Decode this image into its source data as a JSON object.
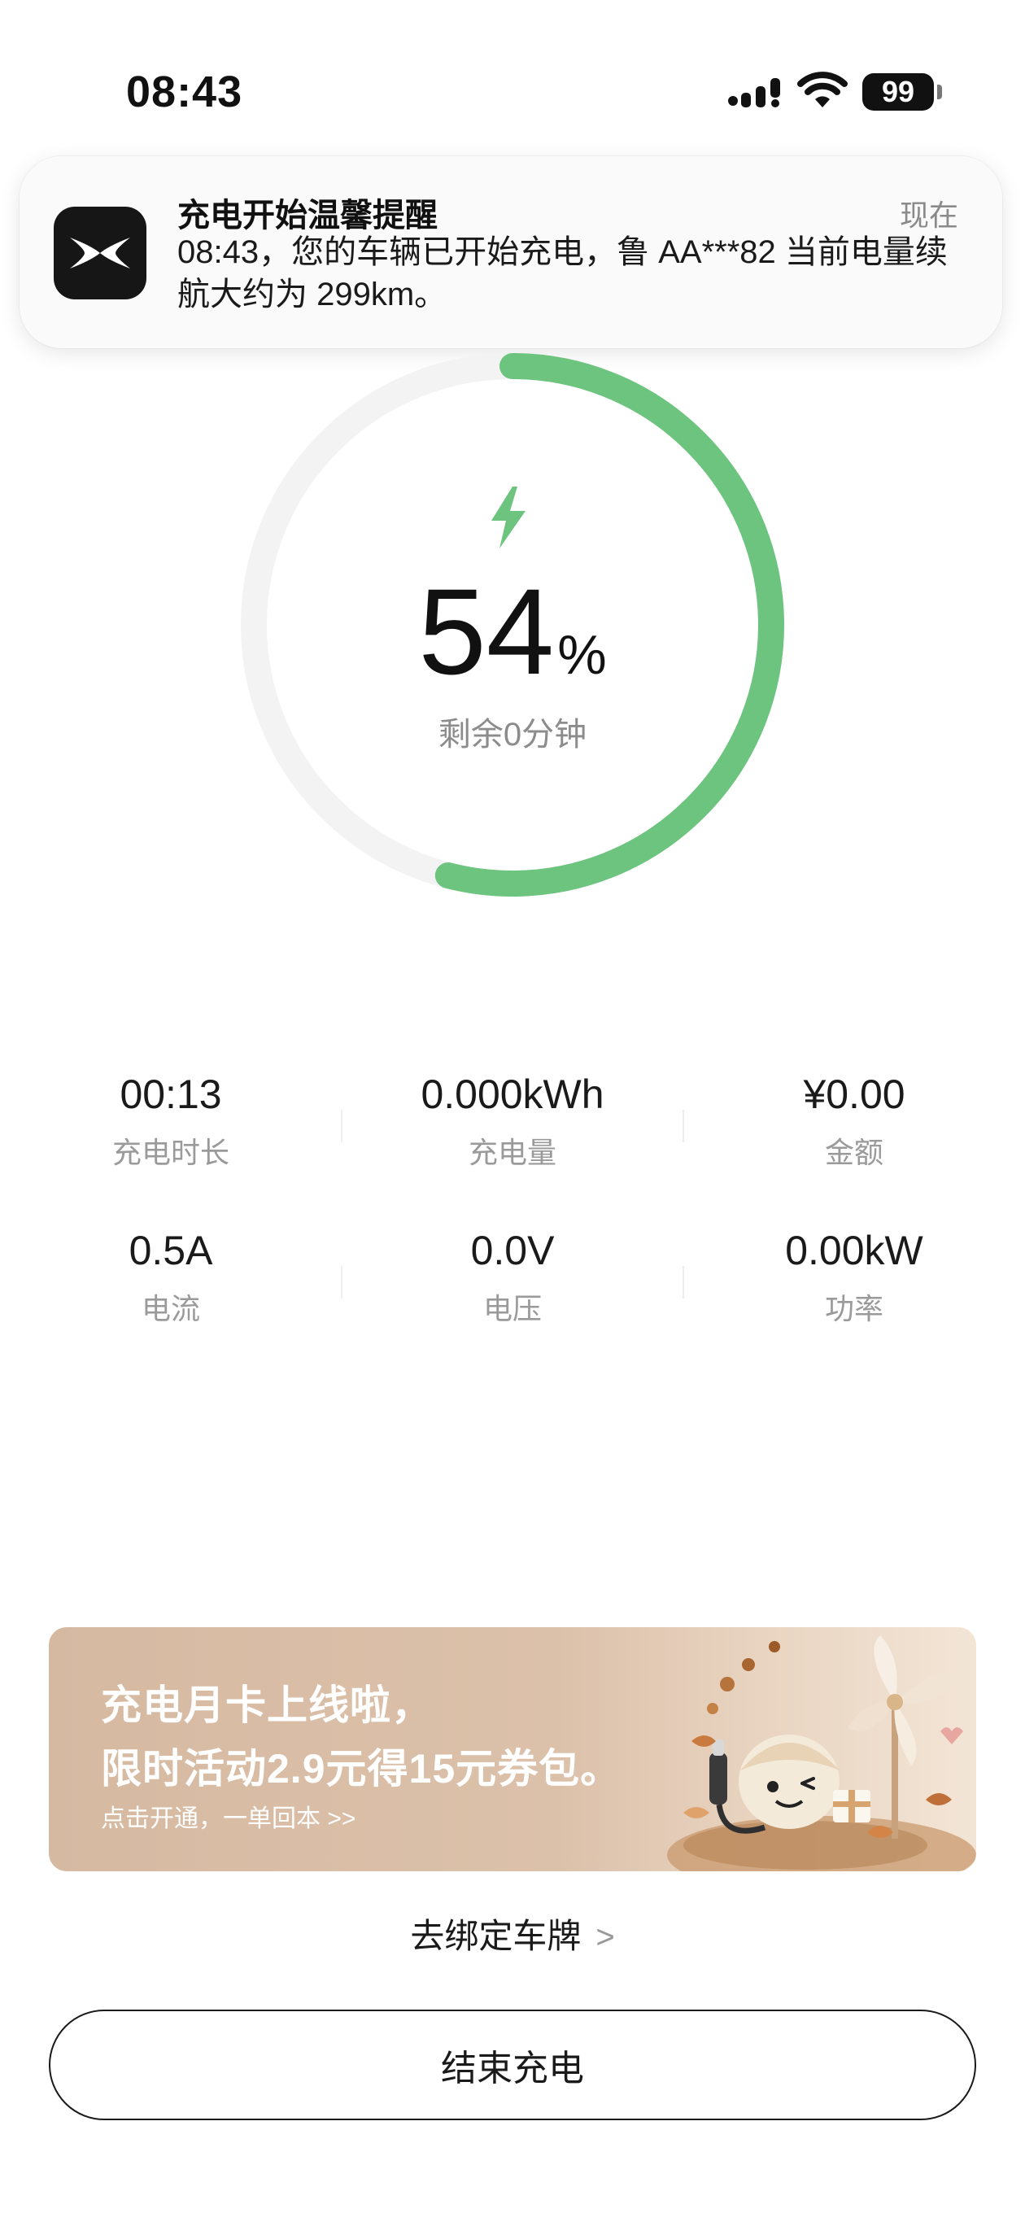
{
  "status_bar": {
    "time": "08:43",
    "battery": "99"
  },
  "notification": {
    "title": "充电开始温馨提醒",
    "time": "现在",
    "body": "08:43，您的车辆已开始充电，鲁 AA***82 当前电量续航大约为 299km。"
  },
  "charging": {
    "percent": "54",
    "percent_unit": "%",
    "progress_fraction": 0.54,
    "remaining": "剩余0分钟",
    "accent_color": "#6dc47f"
  },
  "stats": [
    {
      "value": "00:13",
      "label": "充电时长"
    },
    {
      "value": "0.000kWh",
      "label": "充电量"
    },
    {
      "value": "¥0.00",
      "label": "金额"
    },
    {
      "value": "0.5A",
      "label": "电流"
    },
    {
      "value": "0.0V",
      "label": "电压"
    },
    {
      "value": "0.00kW",
      "label": "功率"
    }
  ],
  "banner": {
    "line1": "充电月卡上线啦，",
    "line2": "限时活动2.9元得15元券包。",
    "cta": "点击开通，一单回本 >>"
  },
  "bind_plate": {
    "label": "去绑定车牌",
    "chevron": ">"
  },
  "end_button": {
    "label": "结束充电"
  }
}
